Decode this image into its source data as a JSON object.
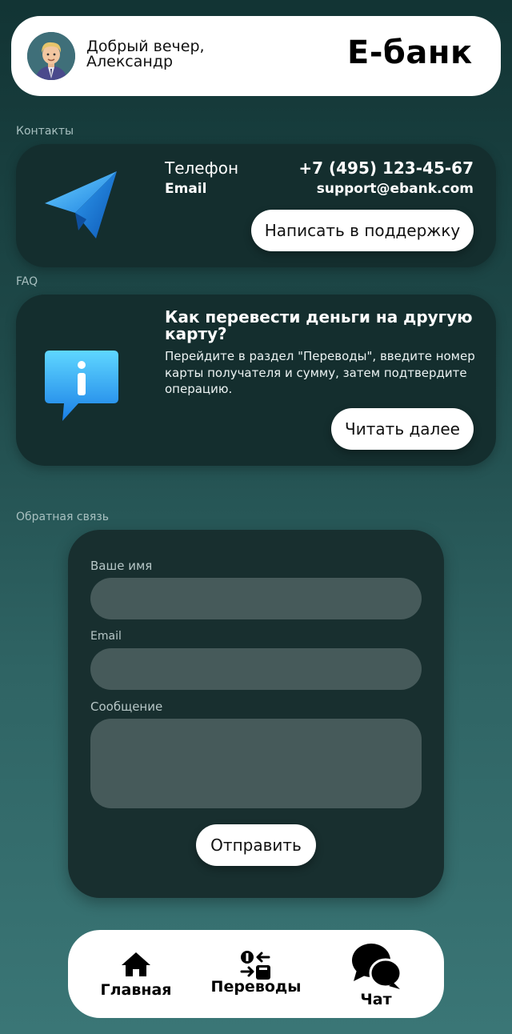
{
  "header": {
    "greeting": "Добрый вечер,",
    "user_name": "Александр",
    "brand": "E-банк"
  },
  "contacts": {
    "section_label": "Контакты",
    "phone_label": "Телефон",
    "phone_value": "+7 (495) 123-45-67",
    "email_label": "Email",
    "email_value": "support@ebank.com",
    "support_button": "Написать в поддержку",
    "icon": "paper-plane-icon"
  },
  "faq": {
    "section_label": "FAQ",
    "question": "Как перевести деньги на другую карту?",
    "answer": "Перейдите в раздел \"Переводы\", введите номер карты получателя и сумму, затем подтвердите операцию.",
    "read_more_button": "Читать далее",
    "icon": "info-bubble-icon"
  },
  "feedback": {
    "section_label": "Обратная связь",
    "name_label": "Ваше имя",
    "name_value": "",
    "email_label": "Email",
    "email_value": "",
    "message_label": "Сообщение",
    "message_value": "",
    "submit_button": "Отправить"
  },
  "nav": {
    "items": [
      {
        "label": "Главная",
        "icon": "home-icon"
      },
      {
        "label": "Переводы",
        "icon": "transfer-icon"
      },
      {
        "label": "Чат",
        "icon": "chat-icon"
      }
    ]
  },
  "colors": {
    "background_top": "#123434",
    "background_bottom": "#3a7676",
    "card": "#142e2e",
    "input": "#465a5a",
    "accent_blue": "#2aa6f2"
  }
}
